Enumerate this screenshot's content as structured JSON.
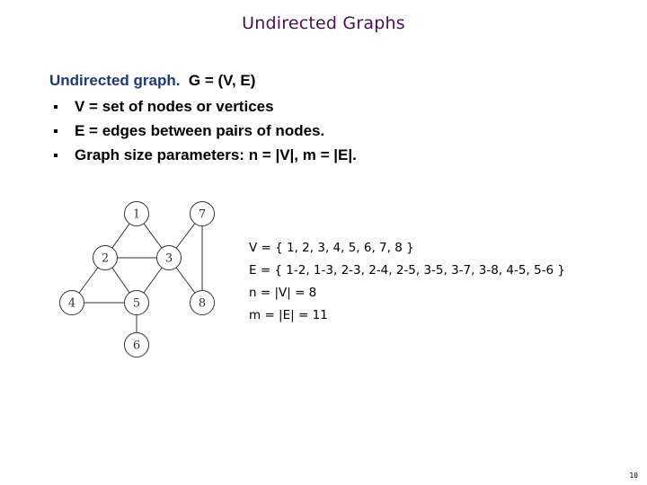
{
  "slide": {
    "title": "Undirected Graphs",
    "intro_lead": "Undirected graph.",
    "intro_rest": "G = (V, E)",
    "bullets": [
      "V = set of nodes or vertices",
      "E = edges between pairs of nodes.",
      "Graph size parameters:  n = |V|, m = |E|."
    ],
    "definitions": {
      "vertices": "V = { 1, 2, 3, 4, 5, 6, 7, 8 }",
      "edges": "E = { 1-2, 1-3, 2-3, 2-4, 2-5, 3-5, 3-7, 3-8, 4-5, 5-6 }",
      "n": "n = |V| = 8",
      "m": "m = |E| = 11"
    },
    "page_number": "10"
  },
  "graph": {
    "nodes": [
      "1",
      "2",
      "3",
      "4",
      "5",
      "6",
      "7",
      "8"
    ],
    "edges": [
      [
        "1",
        "2"
      ],
      [
        "1",
        "3"
      ],
      [
        "2",
        "3"
      ],
      [
        "2",
        "4"
      ],
      [
        "2",
        "5"
      ],
      [
        "3",
        "5"
      ],
      [
        "3",
        "7"
      ],
      [
        "3",
        "8"
      ],
      [
        "4",
        "5"
      ],
      [
        "5",
        "6"
      ],
      [
        "7",
        "8"
      ]
    ]
  }
}
